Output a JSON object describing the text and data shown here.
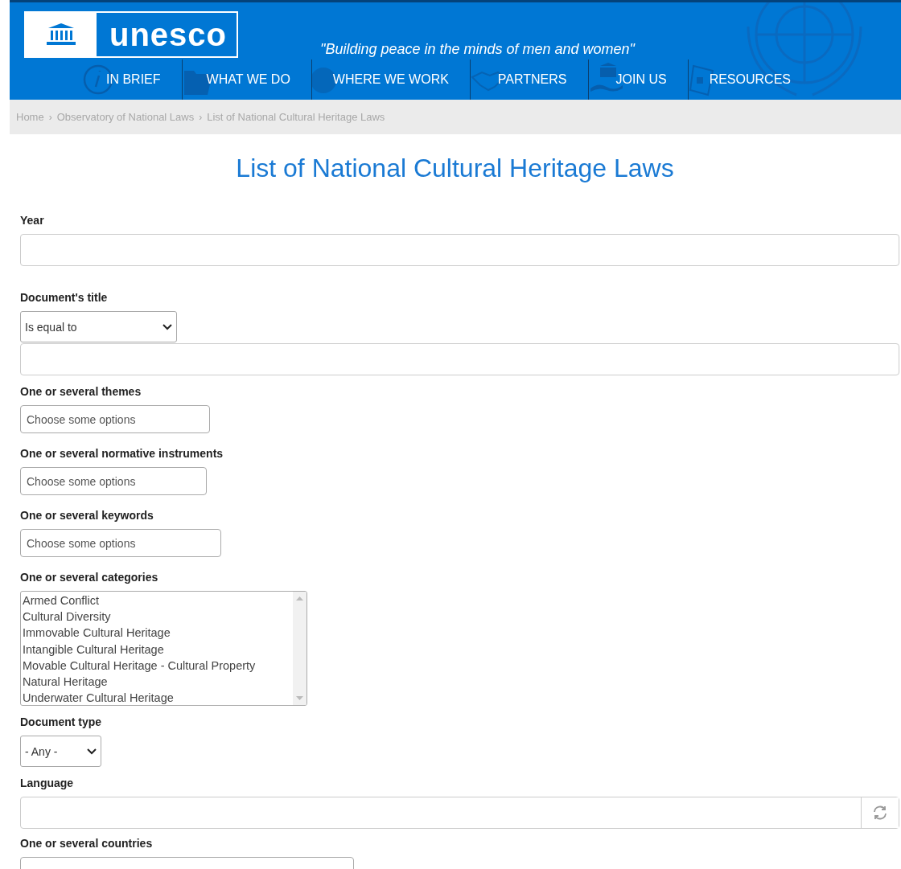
{
  "header": {
    "logo": "unesco",
    "tagline": "\"Building peace in the minds of men and women\"",
    "nav": [
      {
        "label": "IN BRIEF"
      },
      {
        "label": "WHAT WE DO"
      },
      {
        "label": "WHERE WE WORK"
      },
      {
        "label": "PARTNERS"
      },
      {
        "label": "JOIN US"
      },
      {
        "label": "RESOURCES"
      }
    ]
  },
  "breadcrumb": [
    {
      "kind": "link",
      "text": "Home"
    },
    {
      "kind": "separator",
      "text": "›"
    },
    {
      "kind": "link",
      "text": "Observatory of National Laws"
    },
    {
      "kind": "separator",
      "text": "›"
    },
    {
      "kind": "current",
      "text": "List of National Cultural Heritage Laws"
    }
  ],
  "title": "List of National Cultural Heritage Laws",
  "fields": [
    {
      "kind": "text",
      "label": "Year"
    },
    {
      "kind": "select-text",
      "label": "Document's title",
      "value": "Is equal to"
    },
    {
      "kind": "multiselect",
      "label": "One or several themes",
      "placeholder": "Choose some options"
    },
    {
      "kind": "multiselect",
      "label": "One or several normative instruments",
      "placeholder": "Choose some options"
    },
    {
      "kind": "multiselect",
      "label": "One or several keywords",
      "placeholder": "Choose some options"
    },
    {
      "kind": "listbox",
      "label": "One or several categories",
      "options": [
        "Armed Conflict",
        "Cultural Diversity",
        "Immovable Cultural Heritage",
        "Intangible Cultural Heritage",
        "Movable Cultural Heritage - Cultural Property",
        "Natural Heritage",
        "Underwater Cultural Heritage"
      ]
    },
    {
      "kind": "select",
      "label": "Document type",
      "value": "- Any -"
    },
    {
      "kind": "autocomplete",
      "label": "Language"
    },
    {
      "kind": "multiselect",
      "label": "One or several countries"
    }
  ]
}
